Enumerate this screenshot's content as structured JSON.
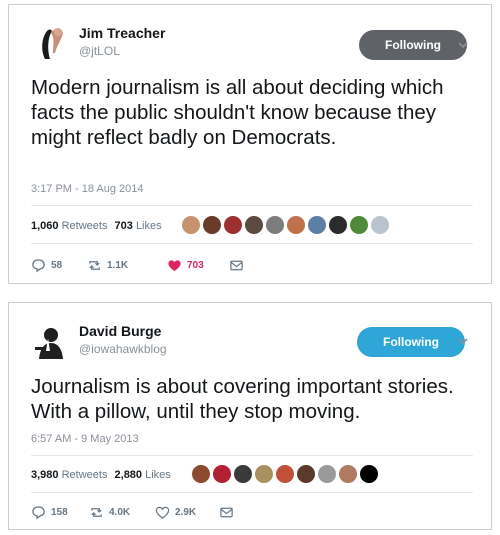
{
  "colors": {
    "button_grey": "#5f6368",
    "button_blue": "#2ea6d8",
    "like_red": "#e0245e",
    "muted": "#657786"
  },
  "tweets": [
    {
      "author_name": "Jim Treacher",
      "handle": "@jtLOL",
      "follow_label": "Following",
      "text": "Modern journalism is all about deciding which facts the public shouldn't know because they might reflect badly on Democrats.",
      "timestamp": "3:17 PM - 18 Aug 2014",
      "retweets": "1,060",
      "retweets_label": "Retweets",
      "likes": "703",
      "likes_label": "Likes",
      "reply_count": "58",
      "retweet_count": "1.1K",
      "like_count": "703"
    },
    {
      "author_name": "David Burge",
      "handle": "@iowahawkblog",
      "follow_label": "Following",
      "text": "Journalism is about covering important stories. With a pillow, until they stop moving.",
      "timestamp": "6:57 AM - 9 May 2013",
      "retweets": "3,980",
      "retweets_label": "Retweets",
      "likes": "2,880",
      "likes_label": "Likes",
      "reply_count": "158",
      "retweet_count": "4.0K",
      "like_count": "2.9K"
    }
  ]
}
